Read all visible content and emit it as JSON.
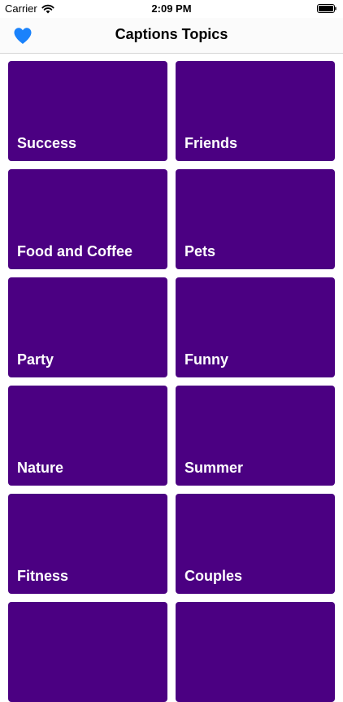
{
  "status_bar": {
    "carrier": "Carrier",
    "time": "2:09 PM",
    "wifi_icon": "wifi-icon",
    "battery_icon": "battery-icon"
  },
  "nav": {
    "title": "Captions Topics",
    "favorite_icon": "heart-icon",
    "accent_color": "#1a82fb"
  },
  "tile_color": "#4b0082",
  "topics": [
    {
      "label": "Success"
    },
    {
      "label": "Friends"
    },
    {
      "label": "Food and Coffee"
    },
    {
      "label": "Pets"
    },
    {
      "label": "Party"
    },
    {
      "label": "Funny"
    },
    {
      "label": "Nature"
    },
    {
      "label": "Summer"
    },
    {
      "label": "Fitness"
    },
    {
      "label": "Couples"
    },
    {
      "label": ""
    },
    {
      "label": ""
    }
  ]
}
